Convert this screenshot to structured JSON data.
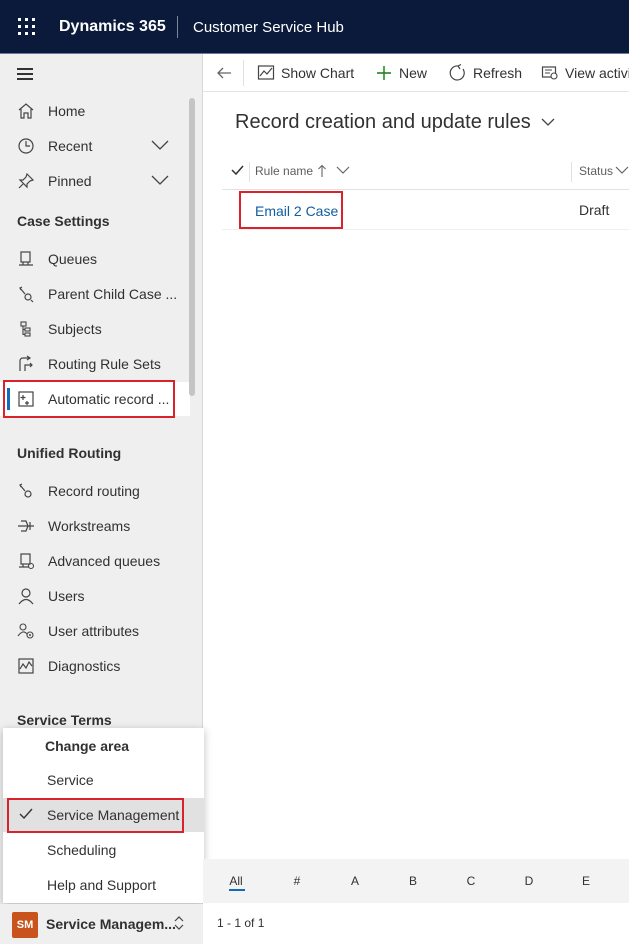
{
  "header": {
    "app_name": "Dynamics 365",
    "app_subtitle": "Customer Service Hub"
  },
  "sidebar": {
    "top_items": [
      {
        "label": "Home",
        "icon": "home-icon"
      },
      {
        "label": "Recent",
        "icon": "clock-icon",
        "expandable": true
      },
      {
        "label": "Pinned",
        "icon": "pin-icon",
        "expandable": true
      }
    ],
    "case_settings": {
      "title": "Case Settings",
      "items": [
        {
          "label": "Queues",
          "icon": "queue-icon"
        },
        {
          "label": "Parent Child Case ...",
          "icon": "parent-child-icon"
        },
        {
          "label": "Subjects",
          "icon": "subjects-icon"
        },
        {
          "label": "Routing Rule Sets",
          "icon": "routing-rules-icon"
        },
        {
          "label": "Automatic record ...",
          "icon": "automatic-record-icon",
          "selected": true
        }
      ]
    },
    "unified_routing": {
      "title": "Unified Routing",
      "items": [
        {
          "label": "Record routing",
          "icon": "record-routing-icon"
        },
        {
          "label": "Workstreams",
          "icon": "workstreams-icon"
        },
        {
          "label": "Advanced queues",
          "icon": "advanced-queues-icon"
        },
        {
          "label": "Users",
          "icon": "user-icon"
        },
        {
          "label": "User attributes",
          "icon": "user-attributes-icon"
        },
        {
          "label": "Diagnostics",
          "icon": "diagnostics-icon"
        }
      ]
    },
    "service_terms": {
      "title": "Service Terms"
    }
  },
  "change_area": {
    "title": "Change area",
    "options": [
      {
        "label": "Service",
        "selected": false
      },
      {
        "label": "Service Management",
        "selected": true
      },
      {
        "label": "Scheduling",
        "selected": false
      },
      {
        "label": "Help and Support",
        "selected": false
      }
    ]
  },
  "area_switcher": {
    "avatar_text": "SM",
    "avatar_color": "#c8531d",
    "label": "Service Managem..."
  },
  "command_bar": {
    "show_chart": "Show Chart",
    "new": "New",
    "refresh": "Refresh",
    "view_activities": "View activi"
  },
  "view": {
    "title": "Record creation and update rules",
    "columns": [
      {
        "label": "Rule name",
        "sort": "ascending"
      },
      {
        "label": "Status"
      }
    ],
    "rows": [
      {
        "rule_name": "Email 2 Case",
        "status": "Draft"
      }
    ]
  },
  "jump_bar": {
    "letters": [
      "All",
      "#",
      "A",
      "B",
      "C",
      "D",
      "E"
    ],
    "active": "All"
  },
  "footer": {
    "record_count": "1 - 1 of 1"
  },
  "colors": {
    "header_bg": "#0b1a3a",
    "accent": "#0f6cbd",
    "highlight_box": "#d9222a",
    "link": "#115ea3"
  }
}
